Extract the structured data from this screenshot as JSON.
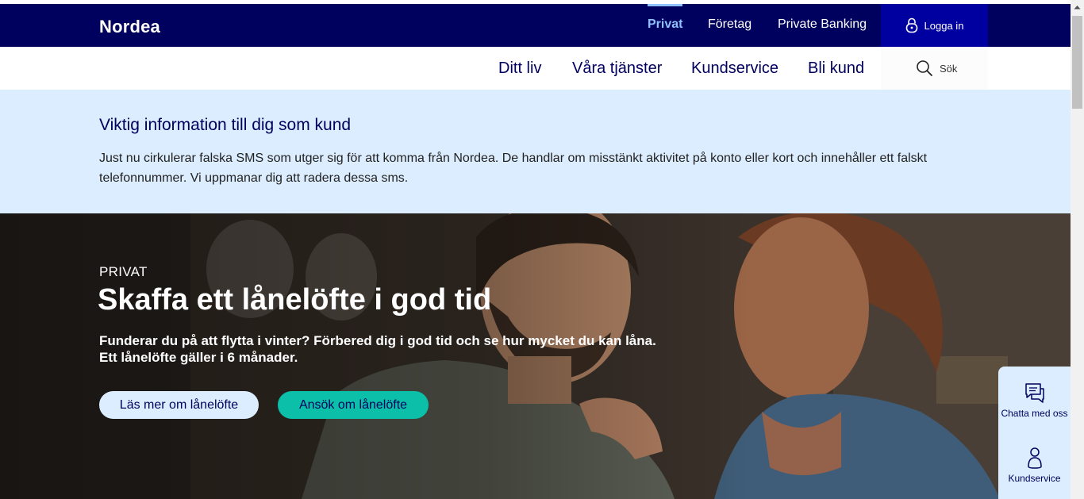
{
  "header": {
    "logo": "Nordea",
    "segments": [
      {
        "label": "Privat",
        "active": true
      },
      {
        "label": "Företag",
        "active": false
      },
      {
        "label": "Private Banking",
        "active": false
      }
    ],
    "login_label": "Logga in"
  },
  "nav": {
    "items": [
      "Ditt liv",
      "Våra tjänster",
      "Kundservice",
      "Bli kund"
    ],
    "search_label": "Sök"
  },
  "banner": {
    "title": "Viktig information till dig som kund",
    "text": "Just nu cirkulerar falska SMS som utger sig för att komma från Nordea. De handlar om misstänkt aktivitet på konto eller kort och innehåller ett falskt telefonnummer. Vi uppmanar dig att radera dessa sms."
  },
  "hero": {
    "eyebrow": "PRIVAT",
    "title": "Skaffa ett lånelöfte i god tid",
    "subtitle_line1": "Funderar du på att flytta i vinter? Förbered dig i god tid och se hur mycket du kan låna.",
    "subtitle_line2": "Ett lånelöfte gäller i 6 månader.",
    "primary_button": "Läs mer om lånelöfte",
    "secondary_button": "Ansök om lånelöfte"
  },
  "help_widget": {
    "chat_label": "Chatta med oss",
    "service_label": "Kundservice"
  },
  "colors": {
    "navy": "#00005e",
    "accent_blue": "#0000a0",
    "light_blue": "#dcedff",
    "teal": "#0bbfa8",
    "active_segment": "#8fc2ff"
  },
  "icons": [
    "lock-icon",
    "search-icon",
    "chat-icon",
    "person-icon",
    "scroll-up-arrow-icon"
  ]
}
